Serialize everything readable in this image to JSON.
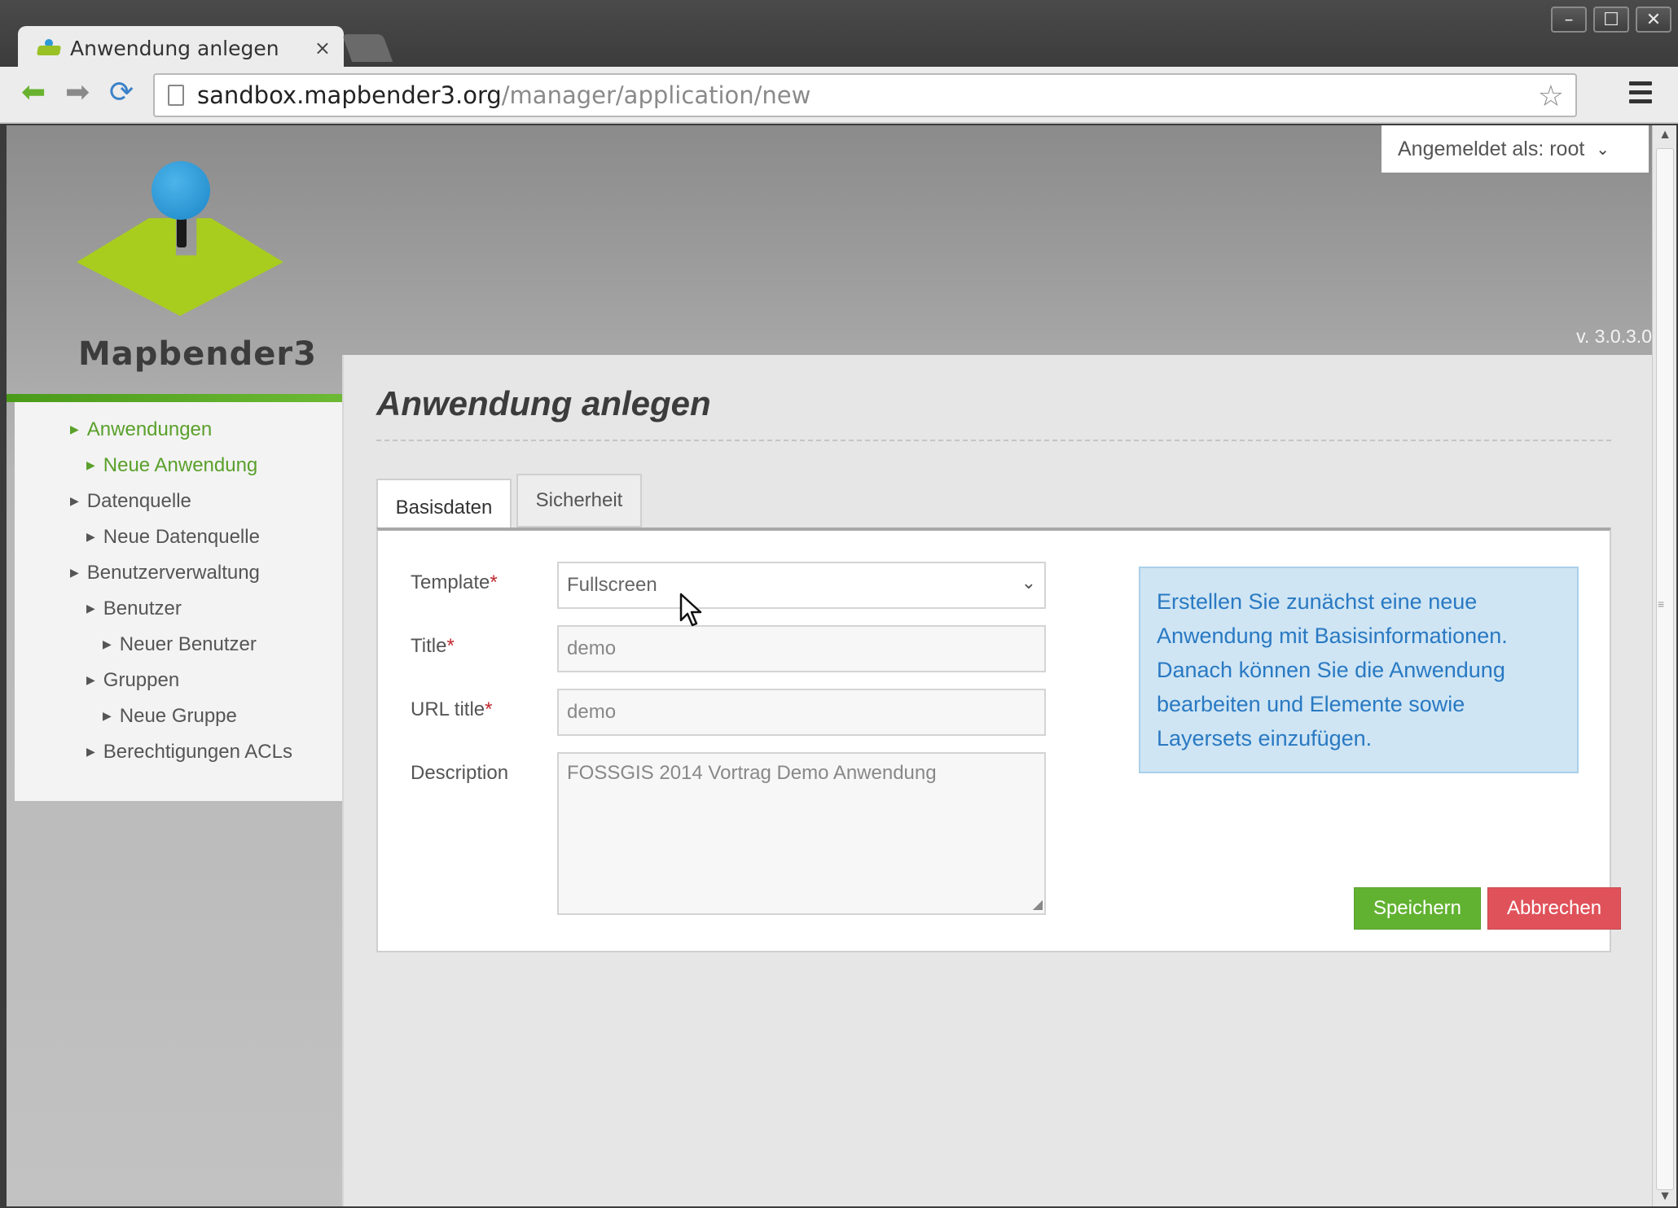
{
  "browser": {
    "tab_title": "Anwendung anlegen",
    "tab_close": "×",
    "url_host": "sandbox.mapbender3.org",
    "url_path": "/manager/application/new",
    "window_buttons": [
      "–",
      "☐",
      "✕"
    ]
  },
  "header": {
    "logo_text": "Mapbender3",
    "user_label": "Angemeldet als: root",
    "version": "v. 3.0.3.0"
  },
  "sidebar": {
    "items": [
      {
        "label": "Anwendungen",
        "active": true
      },
      {
        "label": "Neue Anwendung",
        "active": true
      },
      {
        "label": "Datenquelle",
        "active": false
      },
      {
        "label": "Neue Datenquelle",
        "active": false
      },
      {
        "label": "Benutzerverwaltung",
        "active": false
      },
      {
        "label": "Benutzer",
        "active": false
      },
      {
        "label": "Neuer Benutzer",
        "active": false
      },
      {
        "label": "Gruppen",
        "active": false
      },
      {
        "label": "Neue Gruppe",
        "active": false
      },
      {
        "label": "Berechtigungen ACLs",
        "active": false
      }
    ]
  },
  "main": {
    "title": "Anwendung anlegen",
    "tabs": [
      {
        "label": "Basisdaten",
        "active": true
      },
      {
        "label": "Sicherheit",
        "active": false
      }
    ],
    "form": {
      "template_label": "Template",
      "template_value": "Fullscreen",
      "title_label": "Title",
      "title_value": "demo",
      "url_title_label": "URL title",
      "url_title_value": "demo",
      "description_label": "Description",
      "description_value": "FOSSGIS 2014 Vortrag Demo Anwendung",
      "required_marker": "*"
    },
    "info_text": "Erstellen Sie zunächst eine neue Anwendung mit Basisinformationen. Danach können Sie die Anwendung bearbeiten und Elemente sowie Layersets einzufügen.",
    "save_label": "Speichern",
    "cancel_label": "Abbrechen"
  },
  "colors": {
    "accent_green": "#62b232",
    "cancel_red": "#e0525a",
    "info_blue": "#2979c2",
    "nav_active": "#5aa02b"
  }
}
